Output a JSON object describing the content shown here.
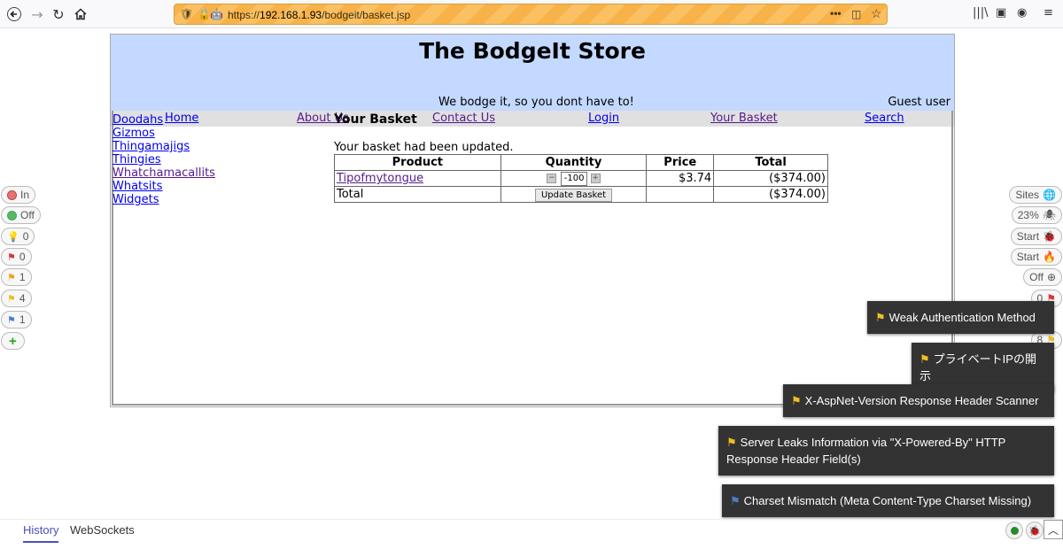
{
  "browser": {
    "url_prefix": "https://",
    "url_host": "192.168.1.93",
    "url_path": "/bodgeit/basket.jsp"
  },
  "store": {
    "title": "The BodgeIt Store",
    "tagline": "We bodge it, so you dont have to!",
    "user": "Guest user",
    "menu": [
      "Home",
      "About Us",
      "Contact Us",
      "Login",
      "Your Basket",
      "Search"
    ],
    "categories": [
      "Doodahs",
      "Gizmos",
      "Thingamajigs",
      "Thingies",
      "Whatchamacallits",
      "Whatsits",
      "Widgets"
    ],
    "heading": "Your Basket",
    "message": "Your basket had been updated.",
    "table": {
      "headers": [
        "Product",
        "Quantity",
        "Price",
        "Total"
      ],
      "row": {
        "product": "Tipofmytongue",
        "quantity": "-100",
        "price": "$3.74",
        "total": "($374.00)"
      },
      "total_label": "Total",
      "update_label": "Update Basket",
      "grand_total": "($374.00)"
    }
  },
  "hud_left": [
    {
      "label": "In",
      "icon": "red-circle-icon"
    },
    {
      "label": "Off",
      "icon": "green-circle-icon"
    },
    {
      "label": "0",
      "icon": "lightbulb-icon"
    },
    {
      "label": "0",
      "icon": "red-flag-icon"
    },
    {
      "label": "1",
      "icon": "orange-flag-icon"
    },
    {
      "label": "4",
      "icon": "yellow-flag-icon"
    },
    {
      "label": "1",
      "icon": "blue-flag-icon"
    }
  ],
  "hud_right": [
    {
      "label": "Sites",
      "icon": "globe-icon"
    },
    {
      "label": "23%",
      "icon": "spider-icon"
    },
    {
      "label": "Start",
      "icon": "bug-icon"
    },
    {
      "label": "Start",
      "icon": "fire-icon"
    },
    {
      "label": "Off",
      "icon": "crosshair-icon"
    },
    {
      "label": "0",
      "icon": "red-flag-icon"
    },
    {
      "label": "8",
      "icon": "yellow-flag-icon"
    }
  ],
  "alerts": [
    "Weak Authentication Method",
    "プライベートIPの開示",
    "X-AspNet-Version Response Header Scanner",
    "Server Leaks Information via \"X-Powered-By\" HTTP Response Header Field(s)",
    "Charset Mismatch (Meta Content-Type Charset Missing)"
  ],
  "bottom_tabs": [
    "History",
    "WebSockets"
  ],
  "colors": {
    "header_bg": "#c3d9ff",
    "menu_bg": "#e0e0e0",
    "link": "#0000ee",
    "visited": "#551a8b",
    "alert_bg": "#333333"
  }
}
